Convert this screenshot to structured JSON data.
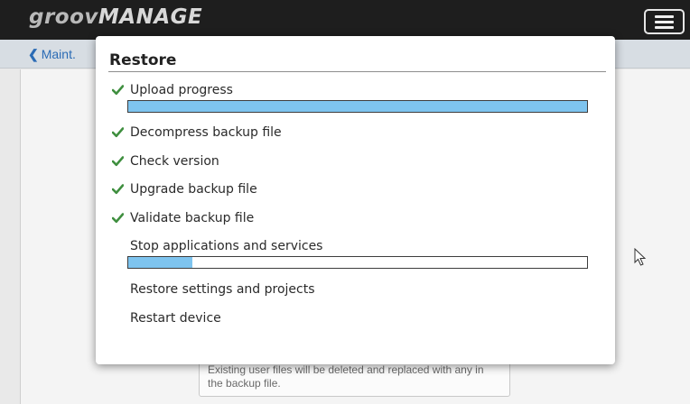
{
  "header": {
    "logo_groov": "groov",
    "logo_manage": "MANAGE",
    "menu_icon": "hamburger-menu-icon"
  },
  "subbar": {
    "back_label": "Maint.",
    "back_icon": "chevron-left-icon"
  },
  "page": {
    "warning_text": "Existing user files will be deleted and replaced with any in the backup file."
  },
  "colors": {
    "header_bg": "#1e1e1e",
    "subbar_bg": "#d7dde3",
    "link": "#2a6bb5",
    "check": "#3f8f3f",
    "progress": "#7ec4ef"
  },
  "modal": {
    "title": "Restore",
    "steps": [
      {
        "label": "Upload progress",
        "done": true,
        "progress": 1.0
      },
      {
        "label": "Decompress backup file",
        "done": true
      },
      {
        "label": "Check version",
        "done": true
      },
      {
        "label": "Upgrade backup file",
        "done": true
      },
      {
        "label": "Validate backup file",
        "done": true
      },
      {
        "label": "Stop applications and services",
        "done": false,
        "progress": 0.14
      },
      {
        "label": "Restore settings and projects",
        "done": false
      },
      {
        "label": "Restart device",
        "done": false
      }
    ]
  }
}
